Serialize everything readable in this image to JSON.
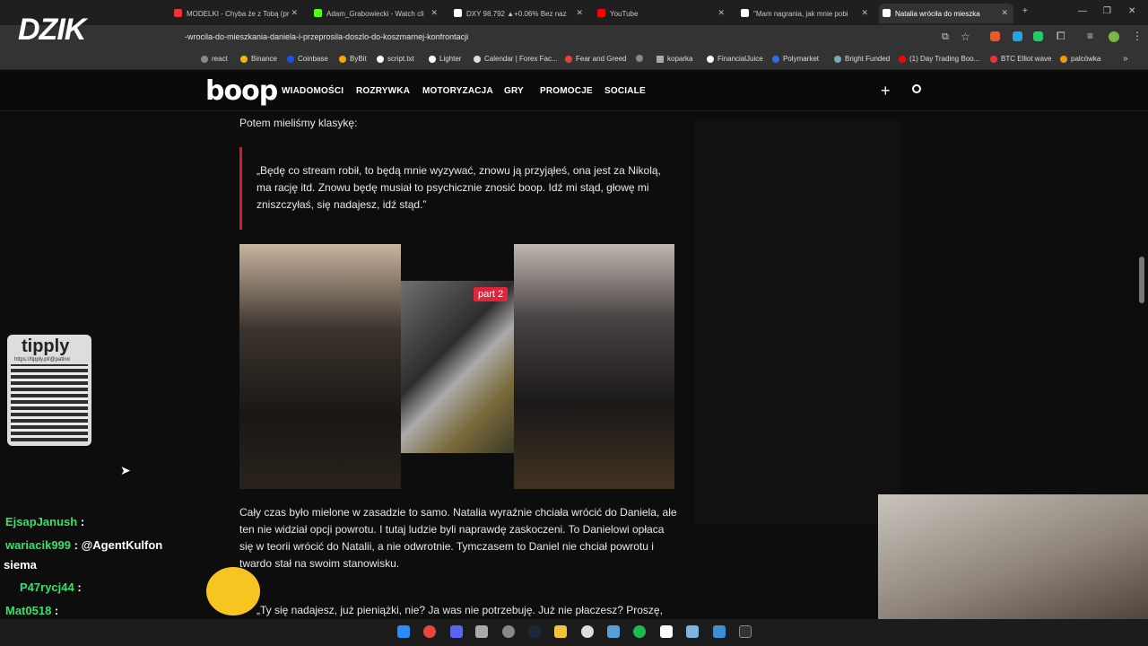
{
  "tabs": [
    {
      "label": "MODELKI - Chyba że z Tobą (pr"
    },
    {
      "label": "Adam_Grabowiecki - Watch cli"
    },
    {
      "label": "DXY 98.792 ▲+0.06% Bez naz"
    },
    {
      "label": "YouTube"
    },
    {
      "label": "\"Mam nagrania, jak mnie pobi"
    },
    {
      "label": "Natalia wróciła do mieszka"
    }
  ],
  "url": "-wrocila-do-mieszkania-daniela-i-przeprosila-doszlo-do-koszmarnej-konfrontacji",
  "bookmarks": [
    "react",
    "Binance",
    "Coinbase",
    "ByBit",
    "script.txt",
    "Lighter",
    "Calendar | Forex Fac...",
    "Fear and Greed",
    "koparka",
    "FinancialJuice",
    "Polymarket",
    "Bright Funded",
    "(1) Day Trading Boo...",
    "BTC Elliot wave",
    "palcówka"
  ],
  "site": {
    "logo": "boop",
    "nav": [
      "WIADOMOŚCI",
      "ROZRYWKA",
      "MOTORYZACJA",
      "GRY",
      "PROMOCJE",
      "SOCIALE"
    ]
  },
  "article": {
    "p1": "Potem mieliśmy klasykę:",
    "quote": "„Będę co stream robił, to będą mnie wyzywać, znowu ją przyjąłeś, ona jest za Nikolą, ma rację itd. Znowu będę musiał to psychicznie znosić boop. Idź mi stąd, głowę mi zniszczyłaś, się nadajesz, idź stąd.”",
    "video_label": "part 2",
    "p2": "Cały czas było mielone w zasadzie to samo. Natalia wyraźnie chciała wrócić do Daniela, ale ten nie widział opcji powrotu. I tutaj ludzie byli naprawdę zaskoczeni. To Danielowi opłaca się w teorii wrócić do Natalii, a nie odwrotnie. Tymczasem to Daniel nie chciał powrotu i twardo stał na swoim stanowisku.",
    "p3": "„Ty się nadajesz, już pieniążki, nie? Ja was nie potrzebuję. Już nie płaczesz? Proszę,"
  },
  "overlay": {
    "brand": "DZIK",
    "tipply": "tipply",
    "tipply_url": "https://tipply.pl/@patino",
    "chat": [
      {
        "user": "EjsapJanush",
        "msg": ""
      },
      {
        "user": "wariacik999",
        "msg": "@AgentKulfon"
      },
      {
        "user": "",
        "msg": "siema"
      },
      {
        "user": "P47rycj44",
        "msg": ""
      },
      {
        "user": "Mat0518",
        "msg": ""
      },
      {
        "user": "wariacik999",
        "msg": "siema"
      }
    ]
  },
  "colors": {
    "accent": "#d11b2d",
    "chat_user": "#37e06a"
  }
}
